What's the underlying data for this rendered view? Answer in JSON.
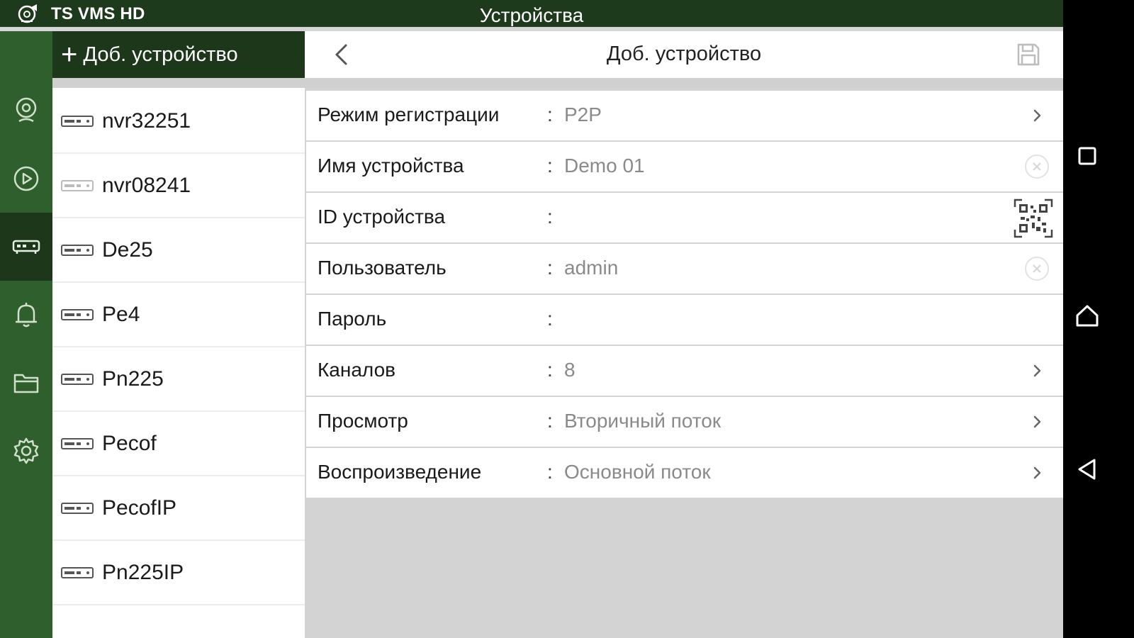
{
  "topbar": {
    "app_title": "TS VMS HD",
    "page_title": "Устройства"
  },
  "rail": {
    "items": [
      {
        "icon": "live-view-camera-icon"
      },
      {
        "icon": "playback-icon"
      },
      {
        "icon": "devices-icon",
        "active": true
      },
      {
        "icon": "alarm-bell-icon"
      },
      {
        "icon": "files-folder-icon"
      },
      {
        "icon": "settings-gear-icon"
      }
    ]
  },
  "device_list": {
    "add_label": "Доб. устройство",
    "items": [
      {
        "name": "nvr32251"
      },
      {
        "name": "nvr08241"
      },
      {
        "name": "De25"
      },
      {
        "name": "Pe4"
      },
      {
        "name": "Pn225"
      },
      {
        "name": "Pecof"
      },
      {
        "name": "PecofIP"
      },
      {
        "name": "Pn225IP"
      }
    ]
  },
  "form": {
    "title": "Доб. устройство",
    "fields": [
      {
        "label": "Режим регистрации",
        "colon": ":",
        "value": "P2P",
        "action": "chevron"
      },
      {
        "label": "Имя устройства",
        "colon": ":",
        "value": "Demo 01",
        "action": "clear"
      },
      {
        "label": "ID устройства",
        "colon": ":",
        "value": "",
        "action": "qr"
      },
      {
        "label": "Пользователь",
        "colon": ":",
        "value": "admin",
        "action": "clear"
      },
      {
        "label": "Пароль",
        "colon": ":",
        "value": "",
        "action": "none"
      },
      {
        "label": "Каналов",
        "colon": ":",
        "value": "8",
        "action": "chevron"
      },
      {
        "label": "Просмотр",
        "colon": ":",
        "value": "Вторичный поток",
        "action": "chevron"
      },
      {
        "label": "Воспроизведение",
        "colon": ":",
        "value": "Основной поток",
        "action": "chevron"
      }
    ]
  },
  "colors": {
    "topbar": "#1e3a1c",
    "rail": "#2f5f2c",
    "rail_active": "#1c3719"
  }
}
